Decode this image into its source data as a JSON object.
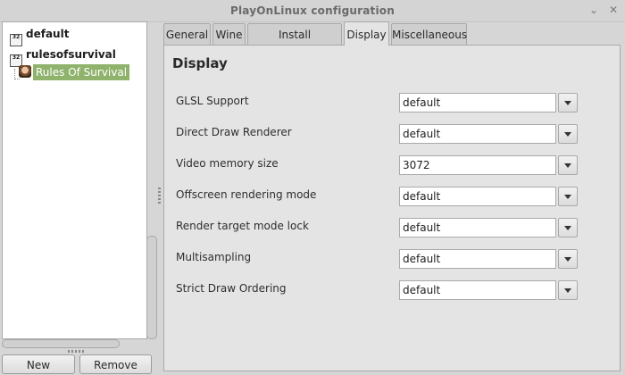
{
  "window": {
    "title": "PlayOnLinux configuration",
    "minimize_glyph": "⌄",
    "close_glyph": "✕"
  },
  "tree": {
    "items": [
      {
        "label": "default",
        "icon": "32",
        "icon_name": "wine-32bit-icon"
      },
      {
        "label": "rulesofsurvival",
        "icon": "32",
        "icon_name": "wine-32bit-icon",
        "children": [
          {
            "label": "Rules Of Survival",
            "icon_name": "game-icon",
            "selected": true
          }
        ]
      }
    ]
  },
  "buttons": {
    "new": "New",
    "remove": "Remove"
  },
  "tabs": [
    {
      "label": "General",
      "active": false
    },
    {
      "label": "Wine",
      "active": false
    },
    {
      "label": "Install components",
      "active": false
    },
    {
      "label": "Display",
      "active": true
    },
    {
      "label": "Miscellaneous",
      "active": false
    }
  ],
  "display": {
    "title": "Display",
    "settings": [
      {
        "label": "GLSL Support",
        "value": "default"
      },
      {
        "label": "Direct Draw Renderer",
        "value": "default"
      },
      {
        "label": "Video memory size",
        "value": "3072"
      },
      {
        "label": "Offscreen rendering mode",
        "value": "default"
      },
      {
        "label": "Render target mode lock",
        "value": "default"
      },
      {
        "label": "Multisampling",
        "value": "default"
      },
      {
        "label": "Strict Draw Ordering",
        "value": "default"
      }
    ]
  },
  "colors": {
    "selection": "#8fb26d",
    "window_bg": "#d6d6d6",
    "panel_bg": "#e4e4e4"
  }
}
